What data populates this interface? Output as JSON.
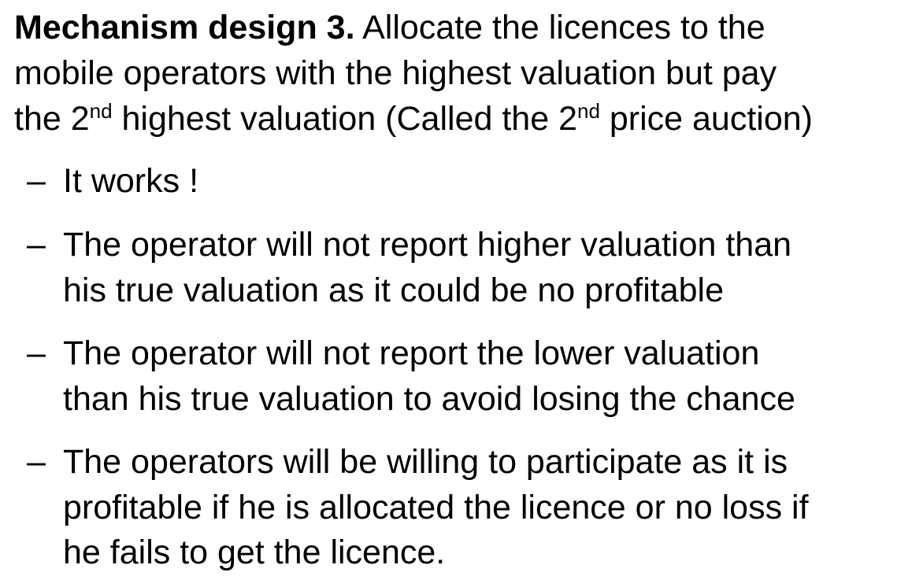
{
  "heading": {
    "bold": "Mechanism design 3.",
    "line1_rest": " Allocate the licences to the",
    "line2": "mobile operators with the highest valuation but pay",
    "line3_a": "the 2",
    "sup1": "nd",
    "line3_b": " highest valuation (Called the 2",
    "sup2": "nd",
    "line3_c": " price auction)"
  },
  "bullet_marker": "–",
  "bullets": [
    {
      "lines": [
        "It works !"
      ]
    },
    {
      "lines": [
        "The operator will not report higher valuation than",
        "his true valuation as it could be no profitable"
      ]
    },
    {
      "lines": [
        "The operator will not report the lower valuation",
        "than his true valuation to avoid losing the chance"
      ]
    },
    {
      "lines": [
        "The operators  will be willing to participate as it is",
        "profitable if he is allocated the licence or no loss if",
        "he fails to get the licence."
      ]
    }
  ]
}
